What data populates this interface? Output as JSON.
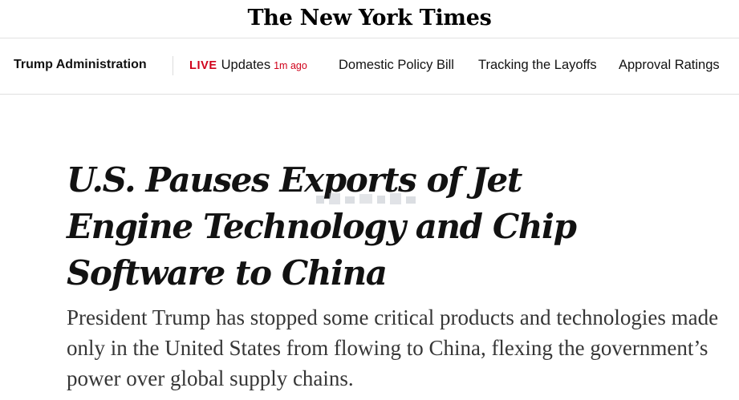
{
  "masthead": {
    "logo_text": "The New York Times"
  },
  "nav": {
    "section": "Trump Administration",
    "live": {
      "badge": "LIVE",
      "label": "Updates",
      "time": "1m ago"
    },
    "links": [
      "Domestic Policy Bill",
      "Tracking the Layoffs",
      "Approval Ratings"
    ]
  },
  "article": {
    "headline": "U.S. Pauses Exports of Jet Engine Technology and Chip Software to China",
    "summary": "President Trump has stopped some critical products and technologies made only in the United States from flowing to China, flexing the government’s power over global supply chains."
  },
  "colors": {
    "live_red": "#d0021b",
    "text": "#121212",
    "summary_text": "#363636",
    "divider": "#e2e2e2"
  }
}
